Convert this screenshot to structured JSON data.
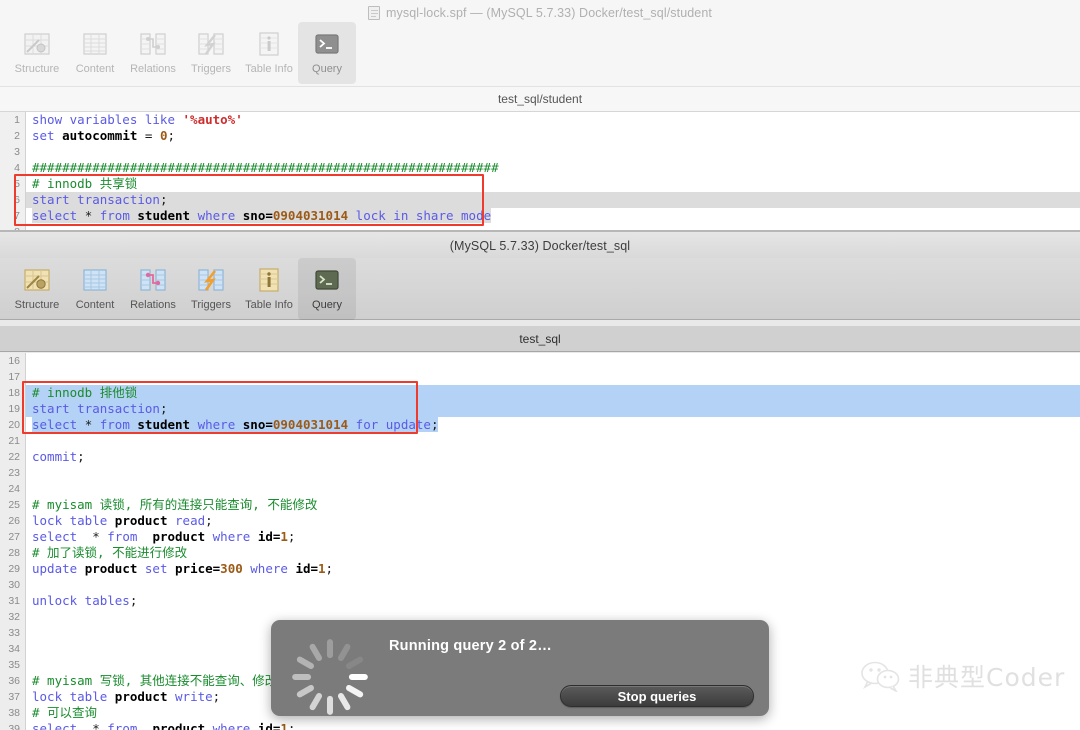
{
  "window_top": {
    "title": "mysql-lock.spf — (MySQL 5.7.33) Docker/test_sql/student",
    "doc_icon": "document-icon",
    "toolbar": {
      "items": [
        {
          "label": "Structure",
          "icon": "structure-icon",
          "selected": false
        },
        {
          "label": "Content",
          "icon": "content-icon",
          "selected": false
        },
        {
          "label": "Relations",
          "icon": "relations-icon",
          "selected": false
        },
        {
          "label": "Triggers",
          "icon": "triggers-icon",
          "selected": false
        },
        {
          "label": "Table Info",
          "icon": "table-info-icon",
          "selected": false
        },
        {
          "label": "Query",
          "icon": "query-icon",
          "selected": true
        }
      ]
    },
    "section_bar": "test_sql/student",
    "editor": {
      "first_line": 1,
      "lines": [
        {
          "n": 1,
          "tokens": [
            {
              "t": "kw",
              "v": "show variables like "
            },
            {
              "t": "str",
              "v": "'%auto%'"
            }
          ]
        },
        {
          "n": 2,
          "tokens": [
            {
              "t": "kw",
              "v": "set "
            },
            {
              "t": "id",
              "v": "autocommit "
            },
            {
              "t": "op",
              "v": "= "
            },
            {
              "t": "num",
              "v": "0"
            },
            {
              "t": "op",
              "v": ";"
            }
          ]
        },
        {
          "n": 3,
          "tokens": []
        },
        {
          "n": 4,
          "tokens": [
            {
              "t": "cmt",
              "v": "##############################################################"
            }
          ]
        },
        {
          "n": 5,
          "tokens": [
            {
              "t": "cmt",
              "v": "# innodb 共享锁"
            }
          ]
        },
        {
          "n": 6,
          "tokens": [
            {
              "t": "kw",
              "v": "start transaction"
            },
            {
              "t": "op",
              "v": ";"
            }
          ]
        },
        {
          "n": 7,
          "tokens": [
            {
              "t": "kw",
              "v": "select "
            },
            {
              "t": "op",
              "v": "* "
            },
            {
              "t": "kw",
              "v": "from "
            },
            {
              "t": "id",
              "v": "student "
            },
            {
              "t": "kw",
              "v": "where "
            },
            {
              "t": "id",
              "v": "sno="
            },
            {
              "t": "num",
              "v": "0904031014 "
            },
            {
              "t": "kw",
              "v": "lock in share mode"
            }
          ]
        },
        {
          "n": 8,
          "tokens": []
        }
      ],
      "selection": {
        "kind": "inactive-gray",
        "from_line": 6,
        "to_line": 7
      },
      "annotation": {
        "kind": "red-rect",
        "from_line": 5,
        "to_line": 7,
        "color": "#ef3b2d"
      }
    }
  },
  "window_main": {
    "title": "(MySQL 5.7.33) Docker/test_sql",
    "toolbar": {
      "items": [
        {
          "label": "Structure",
          "icon": "structure-icon",
          "selected": false
        },
        {
          "label": "Content",
          "icon": "content-icon",
          "selected": false
        },
        {
          "label": "Relations",
          "icon": "relations-icon",
          "selected": false
        },
        {
          "label": "Triggers",
          "icon": "triggers-icon",
          "selected": false
        },
        {
          "label": "Table Info",
          "icon": "table-info-icon",
          "selected": false
        },
        {
          "label": "Query",
          "icon": "query-icon",
          "selected": true
        }
      ]
    },
    "section_bar": "test_sql",
    "editor": {
      "first_line": 16,
      "lines": [
        {
          "n": 16,
          "tokens": []
        },
        {
          "n": 17,
          "tokens": []
        },
        {
          "n": 18,
          "tokens": [
            {
              "t": "cmt",
              "v": "# innodb 排他锁"
            }
          ]
        },
        {
          "n": 19,
          "tokens": [
            {
              "t": "kw",
              "v": "start transaction"
            },
            {
              "t": "op",
              "v": ";"
            }
          ]
        },
        {
          "n": 20,
          "tokens": [
            {
              "t": "kw",
              "v": "select "
            },
            {
              "t": "op",
              "v": "* "
            },
            {
              "t": "kw",
              "v": "from "
            },
            {
              "t": "id",
              "v": "student "
            },
            {
              "t": "kw",
              "v": "where "
            },
            {
              "t": "id",
              "v": "sno="
            },
            {
              "t": "num",
              "v": "0904031014 "
            },
            {
              "t": "kw",
              "v": "for update"
            },
            {
              "t": "op",
              "v": ";"
            }
          ]
        },
        {
          "n": 21,
          "tokens": []
        },
        {
          "n": 22,
          "tokens": [
            {
              "t": "kw",
              "v": "commit"
            },
            {
              "t": "op",
              "v": ";"
            }
          ]
        },
        {
          "n": 23,
          "tokens": []
        },
        {
          "n": 24,
          "tokens": []
        },
        {
          "n": 25,
          "tokens": [
            {
              "t": "cmt",
              "v": "# myisam 读锁, 所有的连接只能查询, 不能修改"
            }
          ]
        },
        {
          "n": 26,
          "tokens": [
            {
              "t": "kw",
              "v": "lock table "
            },
            {
              "t": "id",
              "v": "product "
            },
            {
              "t": "kw",
              "v": "read"
            },
            {
              "t": "op",
              "v": ";"
            }
          ]
        },
        {
          "n": 27,
          "tokens": [
            {
              "t": "kw",
              "v": "select  "
            },
            {
              "t": "op",
              "v": "* "
            },
            {
              "t": "kw",
              "v": "from  "
            },
            {
              "t": "id",
              "v": "product "
            },
            {
              "t": "kw",
              "v": "where "
            },
            {
              "t": "id",
              "v": "id="
            },
            {
              "t": "num",
              "v": "1"
            },
            {
              "t": "op",
              "v": ";"
            }
          ]
        },
        {
          "n": 28,
          "tokens": [
            {
              "t": "cmt",
              "v": "# 加了读锁, 不能进行修改"
            }
          ]
        },
        {
          "n": 29,
          "tokens": [
            {
              "t": "kw",
              "v": "update "
            },
            {
              "t": "id",
              "v": "product "
            },
            {
              "t": "kw",
              "v": "set "
            },
            {
              "t": "id",
              "v": "price="
            },
            {
              "t": "num",
              "v": "300 "
            },
            {
              "t": "kw",
              "v": "where "
            },
            {
              "t": "id",
              "v": "id="
            },
            {
              "t": "num",
              "v": "1"
            },
            {
              "t": "op",
              "v": ";"
            }
          ]
        },
        {
          "n": 30,
          "tokens": []
        },
        {
          "n": 31,
          "tokens": [
            {
              "t": "kw",
              "v": "unlock tables"
            },
            {
              "t": "op",
              "v": ";"
            }
          ]
        },
        {
          "n": 32,
          "tokens": []
        },
        {
          "n": 33,
          "tokens": []
        },
        {
          "n": 34,
          "tokens": []
        },
        {
          "n": 35,
          "tokens": []
        },
        {
          "n": 36,
          "tokens": [
            {
              "t": "cmt",
              "v": "# myisam 写锁, 其他连接不能查询、修改"
            }
          ]
        },
        {
          "n": 37,
          "tokens": [
            {
              "t": "kw",
              "v": "lock table "
            },
            {
              "t": "id",
              "v": "product "
            },
            {
              "t": "kw",
              "v": "write"
            },
            {
              "t": "op",
              "v": ";"
            }
          ]
        },
        {
          "n": 38,
          "tokens": [
            {
              "t": "cmt",
              "v": "# 可以查询"
            }
          ]
        },
        {
          "n": 39,
          "tokens": [
            {
              "t": "kw",
              "v": "select  "
            },
            {
              "t": "op",
              "v": "* "
            },
            {
              "t": "kw",
              "v": "from  "
            },
            {
              "t": "id",
              "v": "product "
            },
            {
              "t": "kw",
              "v": "where "
            },
            {
              "t": "id",
              "v": "id="
            },
            {
              "t": "num",
              "v": "1"
            },
            {
              "t": "op",
              "v": ";"
            }
          ]
        }
      ],
      "selection": {
        "kind": "active-blue",
        "from_line": 18,
        "to_line": 20
      },
      "annotation": {
        "kind": "red-rect",
        "from_line": 18,
        "to_line": 20,
        "color": "#ef3b2d"
      }
    }
  },
  "progress_dialog": {
    "message": "Running query 2 of 2…",
    "spinner": "loading-spinner-icon",
    "stop_button": "Stop queries"
  },
  "watermark": {
    "icon": "wechat-icon",
    "text": "非典型Coder"
  },
  "colors": {
    "accent_red": "#ef3b2d",
    "selection_blue": "#b4d2f5",
    "selection_gray": "#dcdcdc",
    "keyword": "#5a5ae6",
    "comment": "#1a8c2e",
    "number": "#9c5a16",
    "string": "#cf2d2d",
    "dialog_bg": "#7b7b7b"
  }
}
